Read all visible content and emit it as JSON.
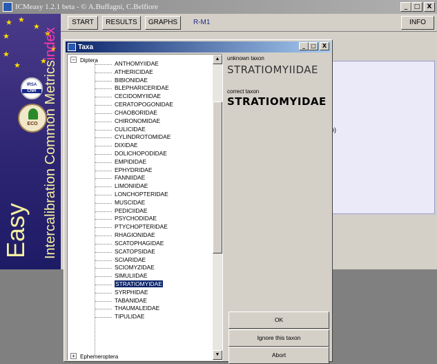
{
  "main_window": {
    "title": "ICMeasy 1.2.1 beta - © A.Buffagni, C.Belfiore",
    "controls": {
      "minimize": "_",
      "maximize": "□",
      "close": "X"
    }
  },
  "logo": {
    "vertical_text": "Intercalibration Common Metrics",
    "vertical_index": "index",
    "easy": "Easy",
    "badge1_top": "IRSA",
    "badge1_bottom": "CNR",
    "badge2": "ECO"
  },
  "menu": {
    "start": "START",
    "results": "RESULTS",
    "graphs": "GRAPHS",
    "mode": "R-M1",
    "info": "INFO"
  },
  "background_fragment": "o)",
  "dialog": {
    "title": "Taxa",
    "controls": {
      "minimize": "_",
      "maximize": "□",
      "close": "X"
    },
    "tree": {
      "root_expander": "−",
      "root": "Diptera",
      "items": [
        "ANTHOMYIIDAE",
        "ATHERICIDAE",
        "BIBIONIDAE",
        "BLEPHARICERIDAE",
        "CECIDOMYIIDAE",
        "CERATOPOGONIDAE",
        "CHAOBORIDAE",
        "CHIRONOMIDAE",
        "CULICIDAE",
        "CYLINDROTOMIDAE",
        "DIXIDAE",
        "DOLICHOPODIDAE",
        "EMPIDIDAE",
        "EPHYDRIDAE",
        "FANNIIDAE",
        "LIMONIIDAE",
        "LONCHOPTERIDAE",
        "MUSCIDAE",
        "PEDICIIDAE",
        "PSYCHODIDAE",
        "PTYCHOPTERIDAE",
        "RHAGIONIDAE",
        "SCATOPHAGIDAE",
        "SCATOPSIDAE",
        "SCIARIDAE",
        "SCIOMYZIDAE",
        "SIMULIIDAE",
        "STRATIOMYIDAE",
        "SYRPHIDAE",
        "TABANIDAE",
        "THAUMALEIDAE",
        "TIPULIDAE"
      ],
      "selected": "STRATIOMYIDAE",
      "footer_expander": "+",
      "footer": "Ephemeroptera"
    },
    "unknown_label": "unknown taxon",
    "unknown_value": "STRATIOMYIIDAE",
    "correct_label": "correct taxon",
    "correct_value": "STRATIOMYIDAE",
    "buttons": {
      "ok": "OK",
      "ignore": "Ignore this taxon",
      "abort": "Abort"
    },
    "scroll_up": "▲",
    "scroll_down": "▼"
  },
  "colors": {
    "selection": "#0a246a",
    "title_gradient_start": "#0a246a",
    "logo_text": "#f4f0a0",
    "logo_index": "#ff3aa8"
  }
}
